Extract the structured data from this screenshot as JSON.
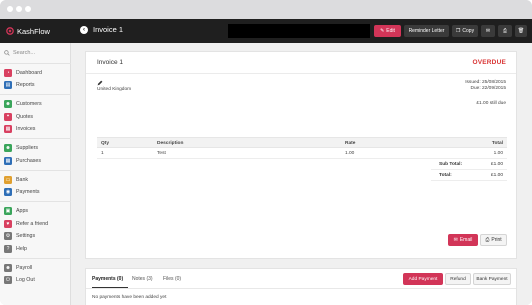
{
  "app": {
    "brand": "KashFlow",
    "page_title": "Invoice 1"
  },
  "header_actions": {
    "edit": "Edit",
    "reminder": "Reminder Letter",
    "copy": "Copy"
  },
  "sidebar": {
    "search_placeholder": "Search...",
    "groups": [
      [
        {
          "label": "Dashboard",
          "icon": "dashboard-icon",
          "color": "#d84060"
        },
        {
          "label": "Reports",
          "icon": "reports-icon",
          "color": "#2f6fb7"
        }
      ],
      [
        {
          "label": "Customers",
          "icon": "customers-icon",
          "color": "#3aa55b"
        },
        {
          "label": "Quotes",
          "icon": "quotes-icon",
          "color": "#d84060"
        },
        {
          "label": "Invoices",
          "icon": "invoices-icon",
          "color": "#d84060"
        }
      ],
      [
        {
          "label": "Suppliers",
          "icon": "suppliers-icon",
          "color": "#3aa55b"
        },
        {
          "label": "Purchases",
          "icon": "purchases-icon",
          "color": "#2f6fb7"
        }
      ],
      [
        {
          "label": "Bank",
          "icon": "bank-icon",
          "color": "#e0a030"
        },
        {
          "label": "Payments",
          "icon": "payments-icon",
          "color": "#2f6fb7"
        }
      ],
      [
        {
          "label": "Apps",
          "icon": "apps-icon",
          "color": "#3aa55b"
        },
        {
          "label": "Refer a friend",
          "icon": "heart-icon",
          "color": "#d84060"
        },
        {
          "label": "Settings",
          "icon": "gear-icon",
          "color": "#777777"
        },
        {
          "label": "Help",
          "icon": "help-icon",
          "color": "#777777"
        }
      ],
      [
        {
          "label": "Payroll",
          "icon": "payroll-icon",
          "color": "#777777"
        },
        {
          "label": "Log Out",
          "icon": "logout-icon",
          "color": "#777777"
        }
      ]
    ]
  },
  "invoice": {
    "title": "Invoice 1",
    "status": "OVERDUE",
    "country": "United Kingdom",
    "issued": "Issued: 25/08/2015",
    "due": "Due: 22/09/2015",
    "still_due": "£1.00 still due",
    "columns": {
      "qty": "Qty",
      "description": "Description",
      "rate": "Rate",
      "total": "Total"
    },
    "lines": [
      {
        "qty": "1",
        "description": "Test",
        "rate": "1.00",
        "total": "1.00"
      }
    ],
    "sub_total_label": "Sub Total:",
    "sub_total": "£1.00",
    "total_label": "Total:",
    "total": "£1.00",
    "email_label": "Email",
    "print_label": "Print"
  },
  "payments_panel": {
    "tabs": [
      "Payments (0)",
      "Notes (3)",
      "Files (0)"
    ],
    "add_payment": "Add Payment",
    "refund": "Refund",
    "bank_payment": "Bank Payment",
    "empty_text": "No payments have been added yet"
  },
  "colors": {
    "accent": "#d23558",
    "overdue": "#d93636",
    "header_bg": "#1f1f1f"
  }
}
